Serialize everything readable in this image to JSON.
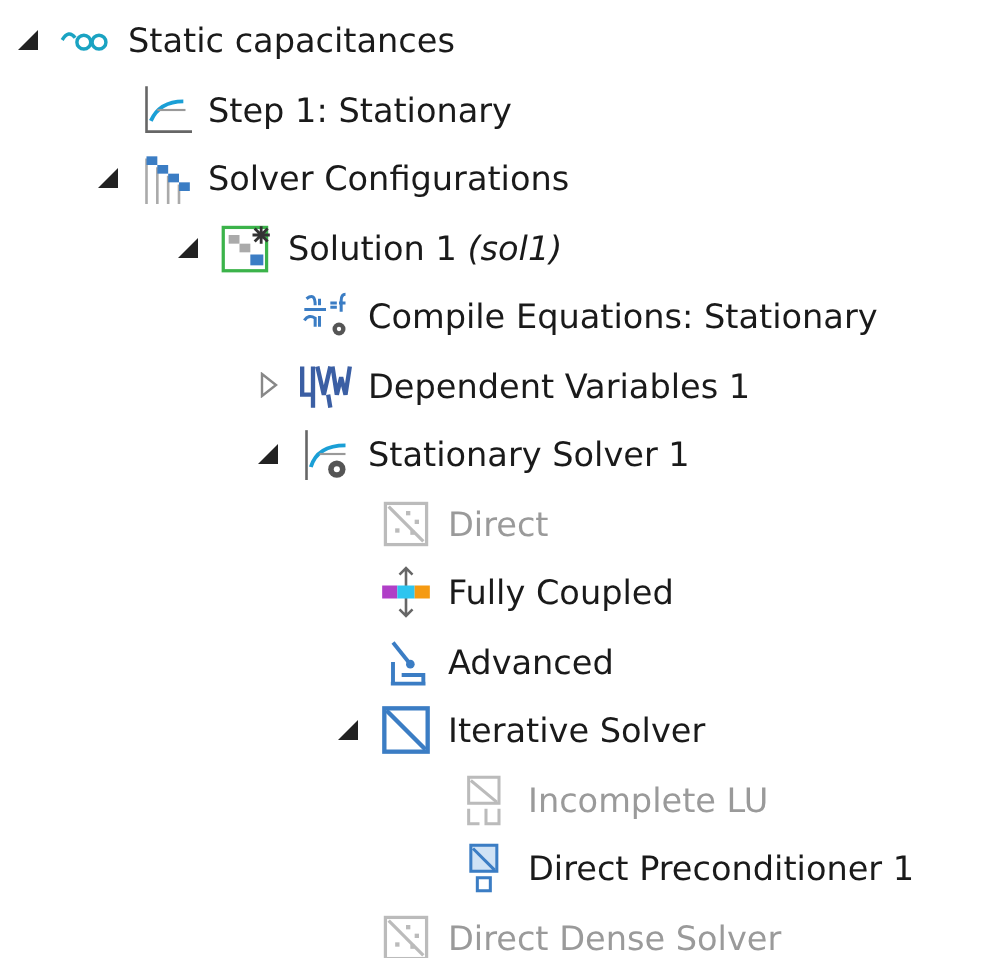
{
  "tree": [
    {
      "label": "Static capacitances",
      "kind": "study",
      "expanded": true,
      "disabled": false,
      "children": [
        {
          "label": "Step 1: Stationary",
          "kind": "step",
          "disabled": false
        },
        {
          "label": "Solver Configurations",
          "kind": "configs",
          "expanded": true,
          "disabled": false,
          "children": [
            {
              "label": "Solution 1 *(sol1)*",
              "kind": "solution",
              "expanded": true,
              "disabled": false,
              "children": [
                {
                  "label": "Compile Equations: Stationary",
                  "kind": "compile",
                  "disabled": false
                },
                {
                  "label": "Dependent Variables 1",
                  "kind": "depvars",
                  "expanded": false,
                  "disabled": false
                },
                {
                  "label": "Stationary Solver 1",
                  "kind": "stationary",
                  "expanded": true,
                  "disabled": false,
                  "children": [
                    {
                      "label": "Direct",
                      "kind": "direct",
                      "disabled": true
                    },
                    {
                      "label": "Fully Coupled",
                      "kind": "coupled",
                      "disabled": false
                    },
                    {
                      "label": "Advanced",
                      "kind": "advanced",
                      "disabled": false
                    },
                    {
                      "label": "Iterative Solver",
                      "kind": "iterative",
                      "expanded": true,
                      "disabled": false,
                      "children": [
                        {
                          "label": "Incomplete LU",
                          "kind": "ilu",
                          "disabled": true
                        },
                        {
                          "label": "Direct Preconditioner 1",
                          "kind": "precond",
                          "disabled": false
                        }
                      ]
                    },
                    {
                      "label": "Direct Dense Solver",
                      "kind": "direct",
                      "disabled": true
                    }
                  ]
                }
              ]
            }
          ]
        }
      ]
    }
  ]
}
